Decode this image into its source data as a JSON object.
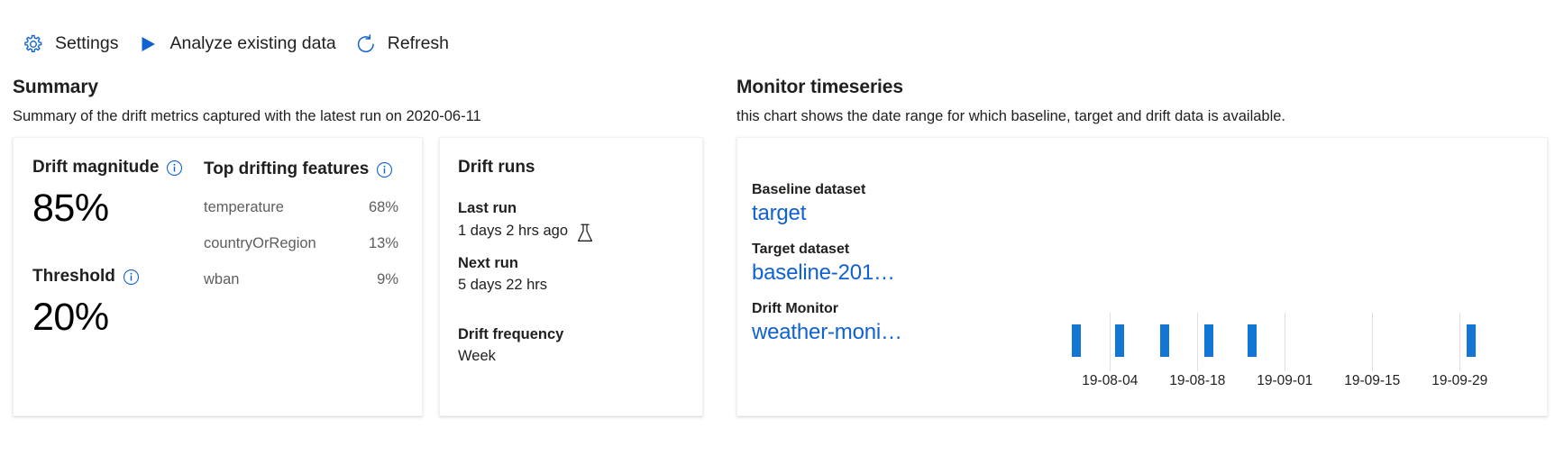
{
  "toolbar": {
    "items": [
      {
        "label": "Settings",
        "icon": "gear-icon",
        "name": "settings"
      },
      {
        "label": "Analyze existing data",
        "icon": "play-triangle-icon",
        "name": "analyze-existing-data"
      },
      {
        "label": "Refresh",
        "icon": "refresh-icon",
        "name": "refresh"
      }
    ]
  },
  "summary": {
    "title": "Summary",
    "description": "Summary of the drift metrics captured with the latest run on 2020-06-11",
    "drift_magnitude": {
      "label": "Drift magnitude",
      "value": "85%",
      "info_icon": "info-icon"
    },
    "threshold": {
      "label": "Threshold",
      "value": "20%",
      "info_icon": "info-icon"
    },
    "top_drifting_features": {
      "label": "Top drifting features",
      "info_icon": "info-icon",
      "rows": [
        {
          "name": "temperature",
          "pct": "68%"
        },
        {
          "name": "countryOrRegion",
          "pct": "13%"
        },
        {
          "name": "wban",
          "pct": "9%"
        }
      ]
    }
  },
  "drift_runs": {
    "title": "Drift runs",
    "last_run_label": "Last run",
    "last_run_value": "1 days 2 hrs ago",
    "last_run_icon": "flask-icon",
    "next_run_label": "Next run",
    "next_run_value": "5 days 22 hrs",
    "frequency_label": "Drift frequency",
    "frequency_value": "Week"
  },
  "timeseries": {
    "title": "Monitor timeseries",
    "description": "this chart shows the date range for which baseline, target and drift data is available.",
    "legend": [
      {
        "key": "Baseline dataset",
        "link": "target",
        "name": "baseline-dataset"
      },
      {
        "key": "Target dataset",
        "link": "baseline-201…",
        "name": "target-dataset"
      },
      {
        "key": "Drift Monitor",
        "link": "weather-moni…",
        "name": "drift-monitor"
      }
    ]
  },
  "colors": {
    "accent": "#0f62d0",
    "bar": "#1376d4",
    "grid": "#e1dfdd",
    "text": "#201f1e",
    "muted": "#605e5c"
  },
  "chart_data": {
    "type": "bar",
    "title": "Monitor timeseries",
    "xlabel": "",
    "ylabel": "",
    "grid": true,
    "legend_position": "left",
    "tick_labels": [
      "19-08-04",
      "19-08-18",
      "19-09-01",
      "19-09-15",
      "19-09-29"
    ],
    "tick_positions_pct": [
      30.5,
      44.7,
      58.9,
      73.1,
      87.3
    ],
    "gridline_positions_pct": [
      30.5,
      44.7,
      58.9,
      73.1,
      87.3
    ],
    "series": [
      {
        "name": "Drift Monitor",
        "color": "#1376d4",
        "bars": [
          {
            "x_pct": 24.3,
            "value": 1
          },
          {
            "x_pct": 31.4,
            "value": 1
          },
          {
            "x_pct": 38.6,
            "value": 1
          },
          {
            "x_pct": 45.8,
            "value": 1
          },
          {
            "x_pct": 52.9,
            "value": 1
          },
          {
            "x_pct": 88.5,
            "value": 1
          }
        ]
      }
    ]
  }
}
